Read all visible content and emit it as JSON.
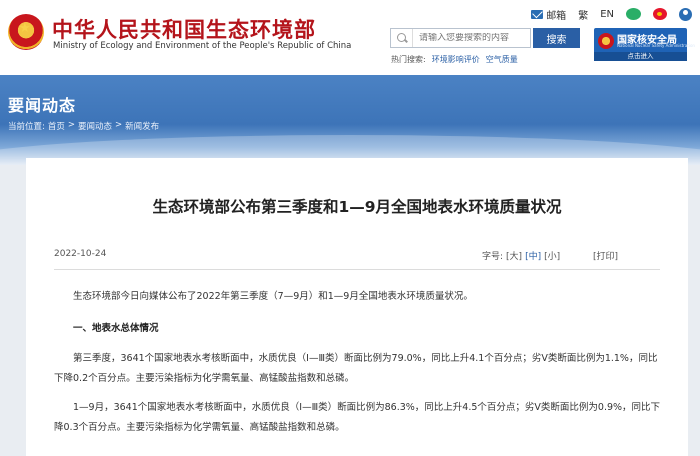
{
  "header": {
    "site_title": "中华人民共和国生态环境部",
    "site_subtitle": "Ministry of Ecology and Environment of the People's Republic of China",
    "top_links": {
      "mail": "邮箱",
      "traditional": "繁",
      "english": "EN"
    },
    "search": {
      "placeholder": "请输入您要搜索的内容",
      "button": "搜索"
    },
    "hot_search": {
      "label": "热门搜索:",
      "items": [
        "环境影响评价",
        "空气质量"
      ]
    },
    "nnsa": {
      "name": "国家核安全局",
      "english": "National Nuclear Safety Administration",
      "enter": "点击进入"
    }
  },
  "banner": {
    "section_title": "要闻动态",
    "breadcrumb": {
      "label": "当前位置:",
      "items": [
        "首页",
        ">",
        "要闻动态",
        ">",
        "新闻发布"
      ]
    }
  },
  "article": {
    "title": "生态环境部公布第三季度和1—9月全国地表水环境质量状况",
    "date": "2022-10-24",
    "font_size": {
      "label": "字号:",
      "large": "[大]",
      "medium": "[中]",
      "small": "[小]"
    },
    "print": "[打印]",
    "paragraphs": [
      "生态环境部今日向媒体公布了2022年第三季度（7—9月）和1—9月全国地表水环境质量状况。",
      "一、地表水总体情况",
      "第三季度，3641个国家地表水考核断面中，水质优良（Ⅰ—Ⅲ类）断面比例为79.0%，同比上升4.1个百分点；劣Ⅴ类断面比例为1.1%，同比下降0.2个百分点。主要污染指标为化学需氧量、高锰酸盐指数和总磷。",
      "1—9月，3641个国家地表水考核断面中，水质优良（Ⅰ—Ⅲ类）断面比例为86.3%，同比上升4.5个百分点；劣Ⅴ类断面比例为0.9%，同比下降0.3个百分点。主要污染指标为化学需氧量、高锰酸盐指数和总磷。"
    ]
  },
  "colors": {
    "brand_red": "#b4141b",
    "link_blue": "#2a5fa5",
    "banner_blue": "#3d74b8"
  }
}
